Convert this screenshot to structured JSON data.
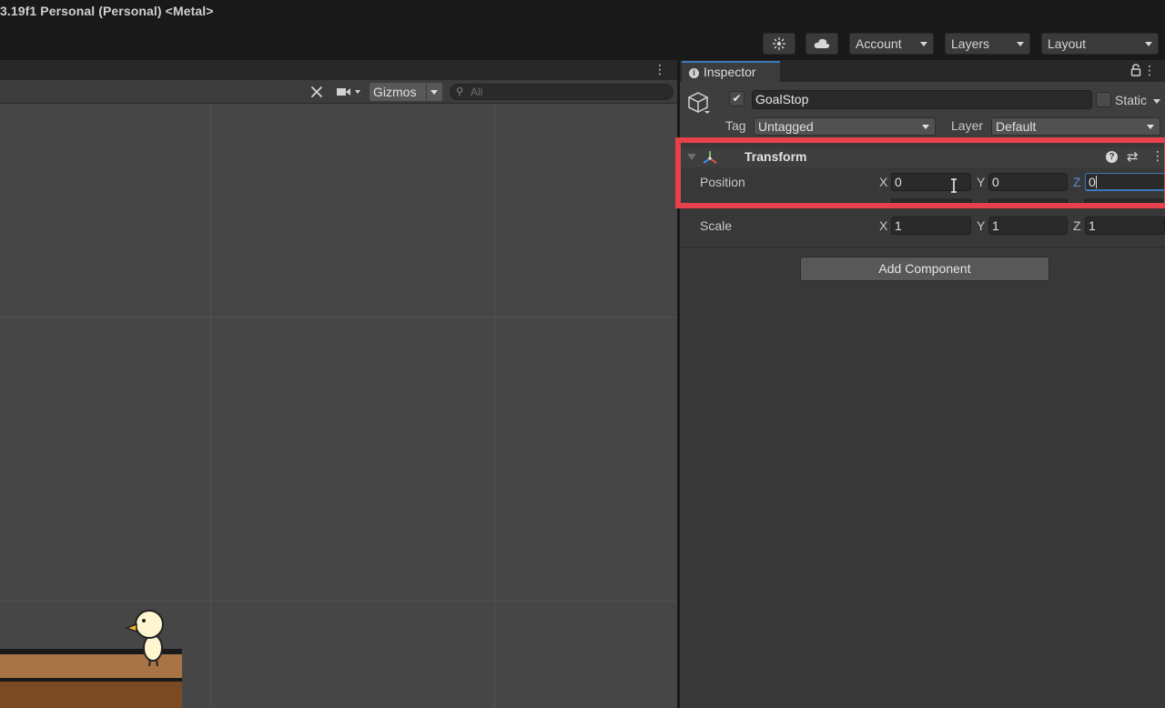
{
  "window": {
    "title": "3.19f1 Personal (Personal) <Metal>"
  },
  "toolbar": {
    "collab_icon": "collab-icon",
    "cloud_icon": "cloud-icon",
    "account_label": "Account",
    "layers_label": "Layers",
    "layout_label": "Layout"
  },
  "scene": {
    "gizmos_label": "Gizmos",
    "search_placeholder": "All",
    "tools_icon": "tools-icon",
    "camera_icon": "camera-icon"
  },
  "inspector": {
    "tab_label": "Inspector",
    "gameobject": {
      "active": true,
      "name": "GoalStop",
      "static_label": "Static",
      "static": false,
      "tag_label": "Tag",
      "tag_value": "Untagged",
      "layer_label": "Layer",
      "layer_value": "Default"
    },
    "transform": {
      "title": "Transform",
      "position": {
        "label": "Position",
        "x": "0",
        "y": "0",
        "z": "0"
      },
      "scale": {
        "label": "Scale",
        "x": "1",
        "y": "1",
        "z": "1"
      },
      "axis_x": "X",
      "axis_y": "Y",
      "axis_z": "Z"
    },
    "add_component_label": "Add Component"
  },
  "colors": {
    "accent": "#3a79bb",
    "highlight": "#e8404b",
    "panel": "#383838",
    "scene_bg": "#464646"
  }
}
